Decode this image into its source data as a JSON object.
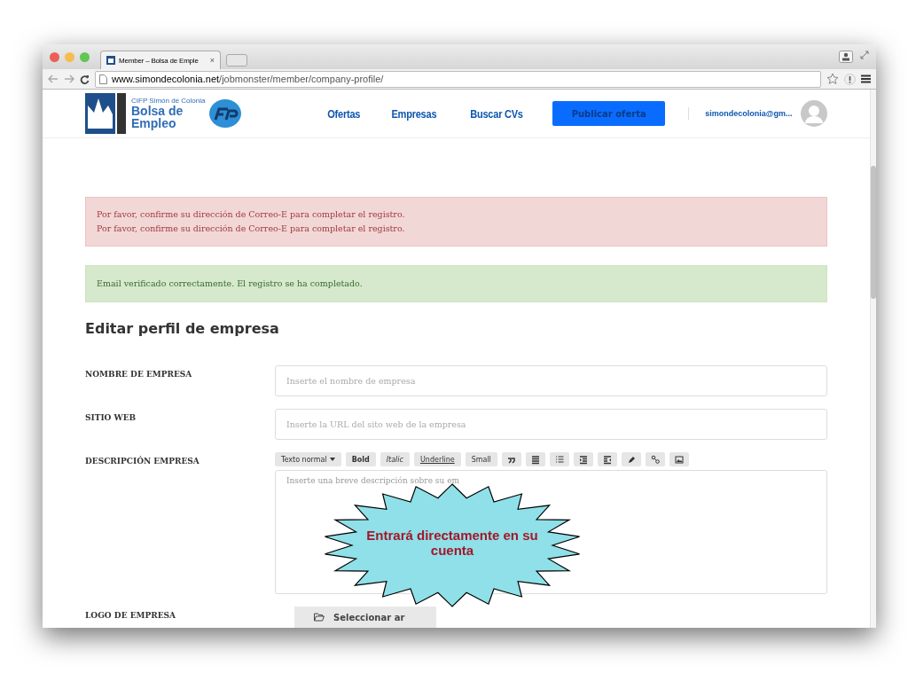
{
  "browser": {
    "tab_title": "Member – Bolsa de Emple",
    "tab_close": "×",
    "url_domain": "www.simondecolonia.net",
    "url_path": "/jobmonster/member/company-profile/"
  },
  "header": {
    "logo": {
      "line1": "CIFP Simón de Colonia",
      "line2": "Bolsa de",
      "line3": "Empleo"
    },
    "nav": [
      {
        "label": "Ofertas"
      },
      {
        "label": "Empresas"
      },
      {
        "label": "Buscar CVs"
      }
    ],
    "cta": "Publicar oferta",
    "user": "simondecolonia@gm..."
  },
  "alerts": [
    {
      "kind": "error",
      "lines": [
        "Por favor, confirme su dirección de Correo-E para completar el registro.",
        "Por favor, confirme su dirección de Correo-E para completar el registro."
      ]
    },
    {
      "kind": "success",
      "lines": [
        "Email verificado correctamente. El registro se ha completado."
      ]
    }
  ],
  "form": {
    "title": "Editar perfil de empresa",
    "fields": [
      {
        "kind": "text",
        "label": "NOMBRE DE EMPRESA",
        "placeholder": "Inserte el nombre de empresa"
      },
      {
        "kind": "text",
        "label": "SITIO WEB",
        "placeholder": "Inserte la URL del sito web de la empresa"
      },
      {
        "kind": "editor",
        "label": "DESCRIPCIÓN EMPRESA",
        "placeholder": "Inserte una breve descripción sobre su em",
        "toolbar": [
          {
            "kind": "dropdown",
            "label": "Texto normal"
          },
          {
            "kind": "bold",
            "label": "Bold"
          },
          {
            "kind": "italic",
            "label": "Italic"
          },
          {
            "kind": "underline",
            "label": "Underline"
          },
          {
            "kind": "small",
            "label": "Small"
          },
          {
            "kind": "quote"
          },
          {
            "kind": "list"
          },
          {
            "kind": "ordered-list"
          },
          {
            "kind": "outdent"
          },
          {
            "kind": "indent"
          },
          {
            "kind": "pen"
          },
          {
            "kind": "link"
          },
          {
            "kind": "image"
          }
        ]
      },
      {
        "kind": "file",
        "label": "LOGO DE EMPRESA",
        "button": "Seleccionar ar"
      }
    ]
  },
  "callout": {
    "text": "Entrará directamente en su cuenta"
  }
}
